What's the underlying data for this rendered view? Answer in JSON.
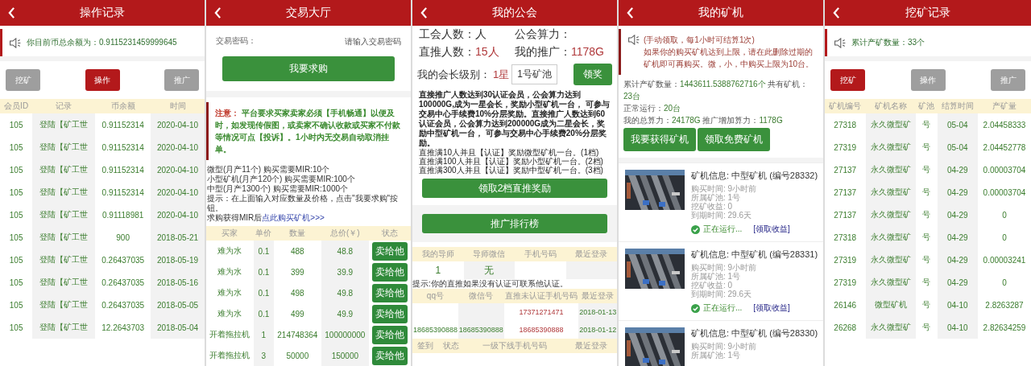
{
  "panels": [
    {
      "kind": "records",
      "title": "操作记录",
      "notice": "你目前币总余额为：0.9115231459999645",
      "tabs": [
        {
          "label": "挖矿",
          "selected": false
        },
        {
          "label": "操作",
          "selected": true
        },
        {
          "label": "推广",
          "selected": false
        }
      ],
      "columns": [
        "会员ID",
        "记录",
        "币余额",
        "时间"
      ],
      "rows": [
        [
          "105",
          "登陆【矿工世",
          "0.91152314",
          "2020-04-10"
        ],
        [
          "105",
          "登陆【矿工世",
          "0.91152314",
          "2020-04-10"
        ],
        [
          "105",
          "登陆【矿工世",
          "0.91152314",
          "2020-04-10"
        ],
        [
          "105",
          "登陆【矿工世",
          "0.91152314",
          "2020-04-10"
        ],
        [
          "105",
          "登陆【矿工世",
          "0.91118981",
          "2020-04-10"
        ],
        [
          "105",
          "登陆【矿工世",
          "900",
          "2018-05-21"
        ],
        [
          "105",
          "登陆【矿工世",
          "0.26437035",
          "2018-05-19"
        ],
        [
          "105",
          "登陆【矿工世",
          "0.26437035",
          "2018-05-16"
        ],
        [
          "105",
          "登陆【矿工世",
          "0.26437035",
          "2018-05-05"
        ],
        [
          "105",
          "登陆【矿工世",
          "12.2643703",
          "2018-05-04"
        ]
      ]
    },
    {
      "kind": "trade",
      "title": "交易大厅",
      "password": {
        "label": "交易密码：",
        "placeholder": "请输入交易密码"
      },
      "submit": "我要求购",
      "notice_label": "注意：",
      "notice_text": "平台要求买家卖家必须【手机畅通】以便及时，如发现传假图，或卖家不确认收款或买家不付款等情况可点【投诉】。1小时内无交易自动取消挂单。",
      "info": [
        "微型(月产11个) 购买需要MIR:10个",
        "小型矿机(月产120个) 购买需要MIR:100个",
        "中型(月产1300个) 购买需要MIR:1000个",
        "提示：在上面输入对应数量及价格，点击\"我要求购\"按钮。"
      ],
      "info_link": {
        "prefix": "求购获得MIR后",
        "link": "点此购买矿机>>>"
      },
      "columns": [
        "买家",
        "单价",
        "数量",
        "总价(￥)",
        "状态"
      ],
      "rows": [
        {
          "cells": [
            "难为水",
            "0.1",
            "488",
            "48.8"
          ],
          "action": "卖给他"
        },
        {
          "cells": [
            "难为水",
            "0.1",
            "399",
            "39.9"
          ],
          "action": "卖给他"
        },
        {
          "cells": [
            "难为水",
            "0.1",
            "498",
            "49.8"
          ],
          "action": "卖给他"
        },
        {
          "cells": [
            "难为水",
            "0.1",
            "499",
            "49.9"
          ],
          "action": "卖给他"
        },
        {
          "cells": [
            "开着拖拉机",
            "1",
            "214748364",
            "100000000"
          ],
          "action": "卖给他"
        },
        {
          "cells": [
            "开着拖拉机",
            "3",
            "50000",
            "150000"
          ],
          "action": "卖给他"
        }
      ]
    },
    {
      "kind": "guild",
      "title": "我的公会",
      "stats": [
        {
          "label": "工会人数：人"
        },
        {
          "label": "公会算力："
        },
        {
          "label": "直推人数：",
          "value": "15人"
        },
        {
          "label": "我的推广：",
          "value": "1178G"
        }
      ],
      "level": {
        "label": "我的会长级别：",
        "value": "1星"
      },
      "pool_select": "1号矿池",
      "claim": "领奖",
      "rules": "直接推广人数达到30认证会员，公会算力达到100000G,成为一星会长，奖励小型矿机一台， 可参与交易中心手续费10%分层奖励。直接推广人数达到60认证会员，公会算力达到200000G成为二星会长，奖励中型矿机一台， 可参与交易中心手续费20%分层奖励。",
      "tiers": [
        "直推满10人并且【认证】奖励微型矿机一台。(1档)",
        "直推满100人并且【认证】奖励小型矿机一台。(2档)",
        "直推满300人并且【认证】奖励中型矿机一台。(3档)"
      ],
      "reward_button": "领取2档直推奖励",
      "ranking_button": "推广排行榜",
      "mentor": {
        "columns": [
          "我的导师",
          "导师微信",
          "手机号码",
          "最近登录"
        ],
        "rows": [
          [
            "1",
            "无",
            "",
            ""
          ]
        ]
      },
      "hint": "提示:你的直推如果没有认证可联系他认证。",
      "referrals": {
        "columns": [
          "qq号",
          "微信号",
          "直推未认证手机号码",
          "最近登录"
        ],
        "rows": [
          [
            "",
            "",
            "17371271471",
            "2018-01-13"
          ],
          [
            "18685390888",
            "18685390888",
            "18685390888",
            "2018-01-12"
          ]
        ]
      },
      "downline": {
        "columns": [
          "签到",
          "状态",
          "一级下线手机号码",
          "最近登录"
        ]
      }
    },
    {
      "kind": "machines",
      "title": "我的矿机",
      "notice_head": "(手动领取，每1小时可结算1次)",
      "notice_text": "如果你的购买矿机达到上限，请在此删除过期的矿机即可再购买。微，小，中购买上限为10台。",
      "stats": [
        [
          {
            "kind": "label",
            "text": "累计产矿数量："
          },
          {
            "kind": "value",
            "text": "1443611.5388762716个"
          },
          {
            "kind": "label",
            "text": "共有矿机："
          },
          {
            "kind": "value",
            "text": "23台"
          }
        ],
        [
          {
            "kind": "label",
            "text": "正常运行："
          },
          {
            "kind": "value",
            "text": "20台"
          }
        ],
        [
          {
            "kind": "label",
            "text": "我的总算力："
          },
          {
            "kind": "value",
            "text": "24178G"
          },
          {
            "kind": "label",
            "text": "推广增加算力："
          },
          {
            "kind": "value",
            "text": "1178G"
          }
        ]
      ],
      "buttons": [
        "我要获得矿机",
        "领取免费矿机"
      ],
      "machines": [
        {
          "title": "矿机信息: 中型矿机 (编号28332)",
          "details": [
            "购买时间: 9小时前",
            "所属矿池: 1号",
            "挖矿收益: 0",
            "到期时间: 29.6天"
          ],
          "status": "正在运行...",
          "link": "[领取收益]"
        },
        {
          "title": "矿机信息: 中型矿机 (编号28331)",
          "details": [
            "购买时间: 9小时前",
            "所属矿池: 1号",
            "挖矿收益: 0",
            "到期时间: 29.6天"
          ],
          "status": "正在运行...",
          "link": "[领取收益]"
        },
        {
          "title": "矿机信息: 中型矿机 (编号28330)",
          "details": [
            "购买时间: 9小时前",
            "所属矿池: 1号"
          ]
        }
      ]
    },
    {
      "kind": "records",
      "title": "挖矿记录",
      "notice": "累计产矿数量：33个",
      "tabs": [
        {
          "label": "挖矿",
          "selected": true
        },
        {
          "label": "操作",
          "selected": false
        },
        {
          "label": "推广",
          "selected": false
        }
      ],
      "columns": [
        "矿机编号",
        "矿机名称",
        "矿池",
        "结算时间",
        "产矿量"
      ],
      "rows": [
        [
          "27318",
          "永久微型矿",
          "号",
          "05-04",
          "2.04458333"
        ],
        [
          "27319",
          "永久微型矿",
          "号",
          "05-04",
          "2.04452778"
        ],
        [
          "27137",
          "永久微型矿",
          "号",
          "04-29",
          "0.00003704"
        ],
        [
          "27137",
          "永久微型矿",
          "号",
          "04-29",
          "0.00003704"
        ],
        [
          "27137",
          "永久微型矿",
          "号",
          "04-29",
          "0"
        ],
        [
          "27318",
          "永久微型矿",
          "号",
          "04-29",
          "0"
        ],
        [
          "27319",
          "永久微型矿",
          "号",
          "04-29",
          "0.00003241"
        ],
        [
          "27319",
          "永久微型矿",
          "号",
          "04-29",
          "0"
        ],
        [
          "26146",
          "微型矿机",
          "号",
          "04-10",
          "2.8263287"
        ],
        [
          "26268",
          "永久微型矿",
          "号",
          "04-10",
          "2.82634259"
        ]
      ]
    }
  ]
}
